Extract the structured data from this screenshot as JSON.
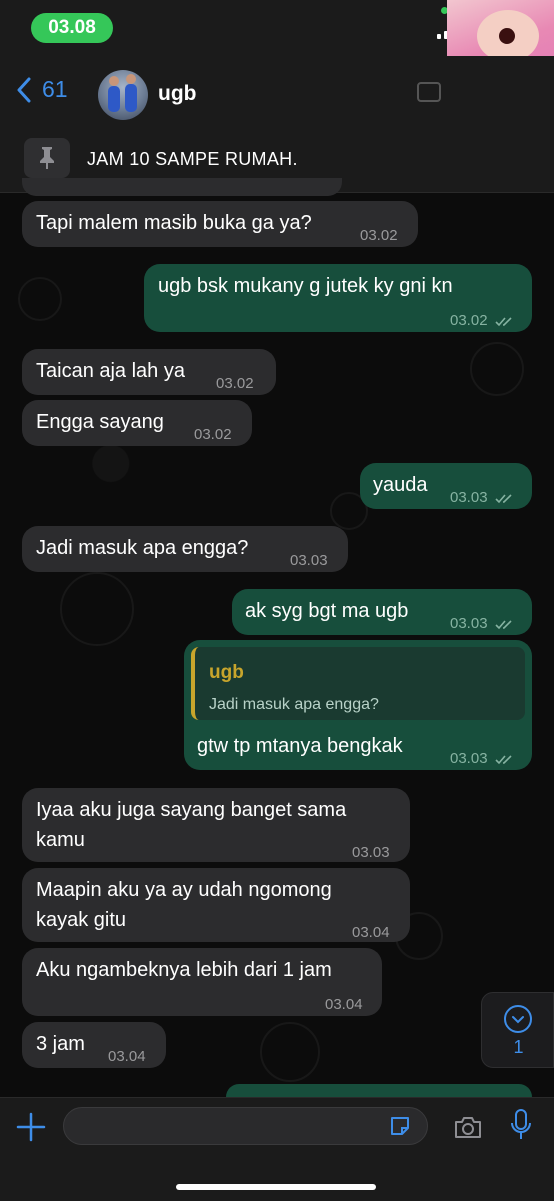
{
  "status_bar": {
    "time": "03.08"
  },
  "header": {
    "back_count": "61",
    "contact_name": "ugb"
  },
  "pinned": {
    "text": "JAM 10 SAMPE RUMAH."
  },
  "messages": [
    {
      "dir": "in",
      "text": "Tapi malem masib buka ga ya?",
      "time": "03.02"
    },
    {
      "dir": "out",
      "text": "ugb bsk mukany g jutek ky gni kn",
      "time": "03.02"
    },
    {
      "dir": "in",
      "text": "Taican aja lah ya",
      "time": "03.02"
    },
    {
      "dir": "in",
      "text": "Engga sayang",
      "time": "03.02"
    },
    {
      "dir": "out",
      "text": "yauda",
      "time": "03.03"
    },
    {
      "dir": "in",
      "text": "Jadi masuk apa engga?",
      "time": "03.03"
    },
    {
      "dir": "out",
      "text": "ak syg bgt ma ugb",
      "time": "03.03"
    },
    {
      "dir": "out",
      "text": "gtw tp mtanya bengkak",
      "time": "03.03",
      "reply": {
        "name": "ugb",
        "text": "Jadi masuk apa engga?"
      }
    },
    {
      "dir": "in",
      "text": "Iyaa aku juga sayang banget sama kamu",
      "line1": "Iyaa aku juga sayang banget sama",
      "line2": "kamu",
      "time": "03.03"
    },
    {
      "dir": "in",
      "text": "Maapin aku ya ay udah ngomong kayak gitu",
      "line1": "Maapin aku ya ay udah ngomong",
      "line2": "kayak gitu",
      "time": "03.04"
    },
    {
      "dir": "in",
      "text": "Aku ngambeknya lebih dari 1 jam",
      "time": "03.04"
    },
    {
      "dir": "in",
      "text": "3 jam",
      "time": "03.04"
    }
  ],
  "scroll_down": {
    "unread_count": "1"
  },
  "input": {
    "placeholder": ""
  },
  "colors": {
    "accent": "#3e8de8",
    "outgoing": "#174e3c",
    "incoming": "#2c2c2e",
    "pill": "#35c759"
  }
}
